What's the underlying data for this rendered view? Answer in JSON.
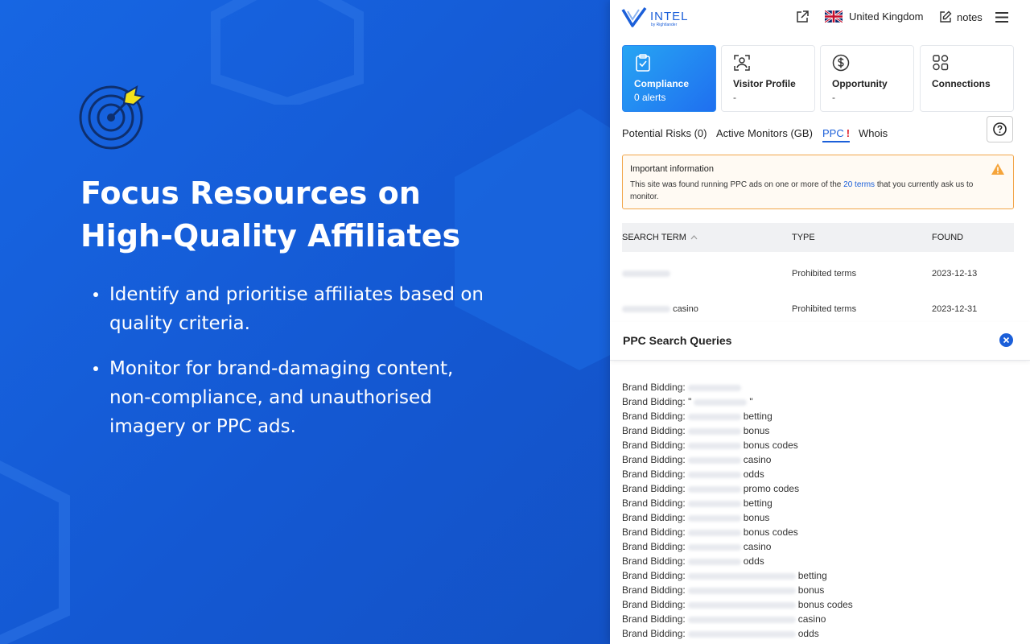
{
  "marketing": {
    "headline_line1": "Focus Resources on",
    "headline_line2": "High-Quality Affiliates",
    "bullets": [
      "Identify and prioritise affiliates based on quality criteria.",
      "Monitor for brand-damaging content, non-compliance, and unauthorised imagery or PPC ads."
    ],
    "accent_color": "#1660db",
    "icon": "target-arrow-icon"
  },
  "header": {
    "logo_text": "INTEL",
    "logo_sub": "by Rightlander",
    "country": "United Kingdom",
    "notes_label": "notes"
  },
  "cards": [
    {
      "title": "Compliance",
      "subtitle": "0 alerts",
      "icon": "clipboard-check-icon",
      "active": true
    },
    {
      "title": "Visitor Profile",
      "subtitle": "-",
      "icon": "user-scan-icon",
      "active": false
    },
    {
      "title": "Opportunity",
      "subtitle": "-",
      "icon": "dollar-circle-icon",
      "active": false
    },
    {
      "title": "Connections",
      "subtitle": "",
      "icon": "network-icon",
      "active": false
    }
  ],
  "tabs": [
    {
      "label": "Potential Risks (0)"
    },
    {
      "label": "Active Monitors (GB)"
    },
    {
      "label": "PPC",
      "badge": "!"
    },
    {
      "label": "Whois"
    }
  ],
  "info": {
    "title": "Important information",
    "text_before": "This site was found running PPC ads on one or more of the ",
    "link": "20 terms",
    "text_after": " that you currently ask us to monitor."
  },
  "table": {
    "headers": [
      "SEARCH TERM",
      "TYPE",
      "FOUND"
    ],
    "rows": [
      {
        "term_suffix": "",
        "type": "Prohibited terms",
        "found": "2023-12-13"
      },
      {
        "term_suffix": "casino",
        "type": "Prohibited terms",
        "found": "2023-12-31"
      }
    ]
  },
  "drawer": {
    "title": "PPC Search Queries",
    "prefix": "Brand Bidding:",
    "queries": [
      {
        "suffix": ""
      },
      {
        "suffix": "\""
      },
      {
        "suffix": "betting"
      },
      {
        "suffix": "bonus"
      },
      {
        "suffix": "bonus codes"
      },
      {
        "suffix": "casino"
      },
      {
        "suffix": "odds"
      },
      {
        "suffix": "promo codes"
      },
      {
        "suffix": "betting"
      },
      {
        "suffix": "bonus"
      },
      {
        "suffix": "bonus codes"
      },
      {
        "suffix": "casino"
      },
      {
        "suffix": "odds"
      },
      {
        "suffix": "betting"
      },
      {
        "suffix": "bonus"
      },
      {
        "suffix": "bonus codes"
      },
      {
        "suffix": "casino"
      },
      {
        "suffix": "odds"
      }
    ]
  }
}
